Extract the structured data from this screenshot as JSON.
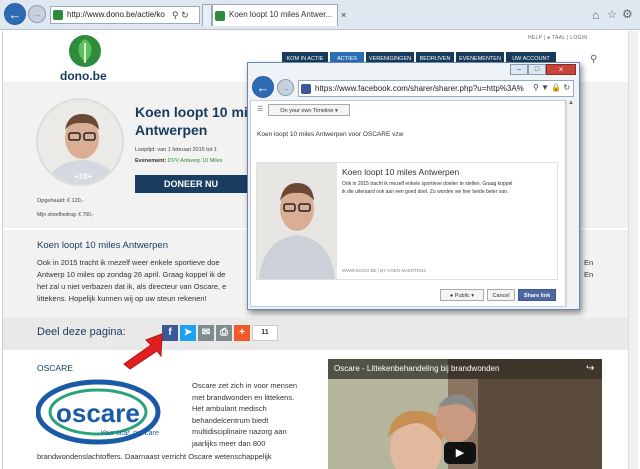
{
  "browser": {
    "url": "http://www.dono.be/actie/ko",
    "tab1_title": "",
    "tab2_title": "Koen loopt 10 miles Antwer..."
  },
  "header": {
    "util_links": [
      "HELP",
      "TAAL",
      "LOGIN"
    ],
    "logo_text": "dono.be",
    "nav": [
      "KOM IN ACTIE",
      "ACTIES",
      "VERENIGINGEN",
      "BEDRIJVEN",
      "EVENEMENTEN",
      "UW ACCOUNT"
    ]
  },
  "campaign": {
    "title_line1": "Koen loopt 10 miles",
    "title_line2": "Antwerpen",
    "looptijd": "Looptijd: van 1 februari 2015 tot 1",
    "evenement_label": "Evenement:",
    "evenement": "DVV Antwerp 10 Miles",
    "donate": "DONEER NU",
    "avatar_badge": "+16+",
    "opgehaald": "Opgehaald: € 120,-",
    "streefbedrag": "Mijn streefbedrag: € 700,-"
  },
  "story": {
    "heading": "Koen loopt 10 miles Antwerpen",
    "line1": "Ook in 2015 tracht ik mezelf weer enkele sportieve doe",
    "line2": "Antwerp 10 miles op zondag 26 april. Graag koppel ik de",
    "line3": "het zal u niet verbazen dat ik, als directeur van Oscare, e",
    "line4": "littekens. Hopelijk kunnen wij op uw steun rekenen!",
    "right1": "En",
    "right2": "En"
  },
  "share": {
    "label": "Deel deze pagina:",
    "count": "11"
  },
  "oscare": {
    "heading": "OSCARE",
    "logo_word": "oscare",
    "tagline": "Your scar, our care",
    "text": [
      "Oscare zet zich in voor mensen",
      "met brandwonden en littekens.",
      "Het ambulant medisch",
      "behandelcentrum biedt",
      "multidisciplinaire nazorg aan",
      "jaarlijks meer dan 800"
    ],
    "bottom": "brandwondenslachtoffers. Daarnaast verricht Oscare wetenschappelijk"
  },
  "video": {
    "title": "Oscare - Littekenbehandeling bij brandwonden"
  },
  "popup": {
    "url": "https://www.facebook.com/sharer/sharer.php?u=http%3A%",
    "timeline": "On your own Timeline",
    "message": "Koen loopt 10 miles Antwerpen voor OSCARE vzw",
    "card_title": "Koen loopt 10 miles Antwerpen",
    "card_text1": "Ook in 2015 tracht ik mezelf enkele sportieve doelen te stellen. Graag koppel",
    "card_text2": "ik die uiteraard ook aan een goed doel. Zo worden we hier beide beter van.",
    "card_domain": "WWW.DONO.BE",
    "card_sep": "|",
    "card_author": "BY KOEN MAERTENS",
    "privacy": "Public",
    "cancel": "Cancel",
    "share": "Share link"
  },
  "colors": {
    "nav": "#183a5c",
    "active": "#2b6fb6",
    "facebook": "#3b5998",
    "twitter": "#1da1f2",
    "email": "#7f8c8d",
    "print": "#7f8c8d",
    "plus": "#f05a24",
    "green": "#2e8b3c",
    "arrow": "#e02020"
  }
}
